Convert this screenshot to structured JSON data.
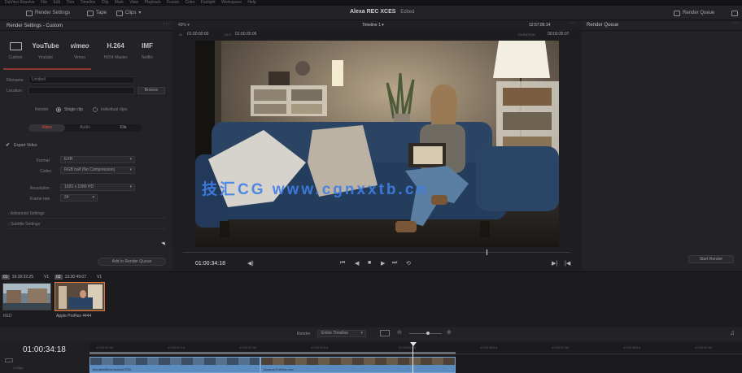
{
  "menubar": {
    "items": [
      "DaVinci Resolve",
      "File",
      "Edit",
      "Trim",
      "Timeline",
      "Clip",
      "Mark",
      "View",
      "Playback",
      "Fusion",
      "Color",
      "Fairlight",
      "Workspace",
      "Help"
    ]
  },
  "toolbar": {
    "render_settings_label": "Render Settings",
    "tape_label": "Tape",
    "clips_label": "Clips",
    "project_name": "Alexa REC XCES",
    "project_status": "Edited",
    "render_queue_label": "Render Queue"
  },
  "render_settings": {
    "title": "Render Settings - Custom",
    "presets": [
      {
        "logo": "YouTube",
        "label": "Custom"
      },
      {
        "logo": "YouTube",
        "label": "Youtube"
      },
      {
        "logo": "vimeo",
        "label": "Vimeo"
      },
      {
        "logo": "H.264",
        "label": "H264 Master"
      },
      {
        "logo": "IMF",
        "label": "Netflix"
      }
    ],
    "filename_label": "Filename",
    "filename_value": "Untitled",
    "location_label": "Location",
    "location_value": "",
    "browse_label": "Browse",
    "render_label": "Render",
    "single_clip_label": "Single clip",
    "individual_clips_label": "Individual clips",
    "tabs": [
      "Video",
      "Audio",
      "File"
    ],
    "export_video_label": "Export Video",
    "format_label": "Format",
    "format_value": "EXR",
    "codec_label": "Codec",
    "codec_value": "RGB half (No Compression)",
    "resolution_label": "Resolution",
    "resolution_value": "1920 x 1080 HD",
    "frame_rate_label": "Frame rate",
    "frame_rate_value": "24",
    "advanced_label": "Advanced Settings",
    "subtitle_label": "Subtitle Settings",
    "add_queue_label": "Add to Render Queue"
  },
  "viewer": {
    "zoom": "49%",
    "timeline_name": "Timeline 1",
    "clock": "12:57:05:14",
    "in_label": "IN",
    "in_value": "01:00:00:00",
    "out_label": "OUT",
    "out_value": "01:00:35:06",
    "duration_label": "DURATION",
    "duration_value": "00:00:35:07",
    "timecode": "01:00:34:18",
    "watermark": "技汇CG www.cgnxxtb.cn"
  },
  "render_queue": {
    "title": "Render Queue",
    "start_label": "Start Render"
  },
  "clips": [
    {
      "index": "01",
      "tc": "19:18:22:25",
      "track": "V1",
      "name": "RED"
    },
    {
      "index": "02",
      "tc": "13:30:49:07",
      "track": "V1",
      "name": "Apple ProRes 4444"
    }
  ],
  "bottom": {
    "render_label": "Render",
    "render_mode": "Entire Timeline",
    "timeline_tc": "01:00:34:18",
    "ruler_ticks": [
      "01:00:30:00",
      "01:00:31:10",
      "01:00:32:00",
      "01:00:33:10",
      "01:00:34:00",
      "01:00:36:10",
      "01:00:37:00",
      "01:00:38:10",
      "01:00:40:00"
    ],
    "clip_a": "blondewithcomicbook.R3D",
    "clip_b": "closeup.ProRes.mov",
    "track_label": "1 Clips"
  },
  "colors": {
    "accent": "#e64b3c",
    "selection": "#e07a3f",
    "clip_blue": "#5b8cbf",
    "panel": "#232326"
  }
}
